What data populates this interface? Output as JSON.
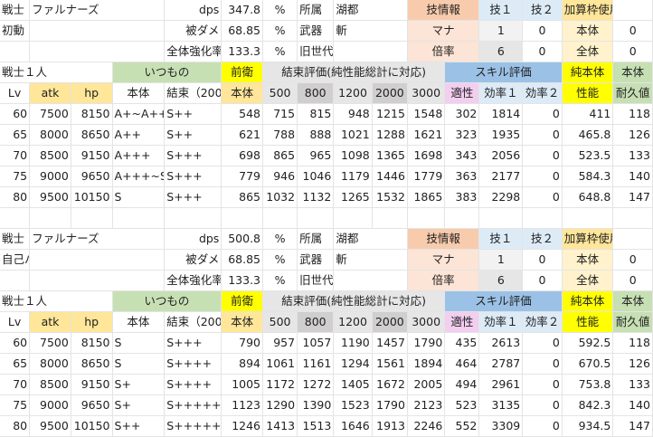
{
  "sheet": {
    "blocks": [
      {
        "info_rows": [
          [
            "戦士",
            "ファルナーズ",
            "",
            "dps",
            "347.8",
            "%",
            "所属",
            "湖都",
            "",
            "技情報",
            "技１",
            "技２",
            "加算枠使用率",
            ""
          ],
          [
            "初動",
            "",
            "",
            "被ダメ",
            "68.85",
            "%",
            "武器",
            "斬",
            "",
            "マナ",
            "1",
            "0",
            "本体",
            "0"
          ],
          [
            "",
            "",
            "",
            "全体強化率",
            "133.3",
            "%",
            "旧世代",
            "",
            "",
            "倍率",
            "6",
            "0",
            "全体",
            "0"
          ]
        ],
        "header_row": [
          "戦士１人",
          "",
          "",
          "いつもの",
          "",
          "前衛",
          "結束評価(純性能総計に対応)",
          "",
          "",
          "",
          "",
          "スキル評価",
          "",
          "",
          "純本体",
          "本体"
        ],
        "col_row": [
          "Lv",
          "atk",
          "hp",
          "本体",
          "結束（2000)",
          "本体",
          "500",
          "800",
          "1200",
          "2000",
          "3000",
          "適性",
          "効率１",
          "効率２",
          "性能",
          "耐久値"
        ],
        "data_rows": [
          [
            "60",
            "7500",
            "8150",
            "A+~A++",
            "S++",
            "548",
            "715",
            "815",
            "948",
            "1215",
            "1548",
            "302",
            "1814",
            "0",
            "411",
            "118"
          ],
          [
            "65",
            "8000",
            "8650",
            "A++",
            "S++",
            "621",
            "788",
            "888",
            "1021",
            "1288",
            "1621",
            "323",
            "1935",
            "0",
            "465.8",
            "126"
          ],
          [
            "70",
            "8500",
            "9150",
            "A+++",
            "S+++",
            "698",
            "865",
            "965",
            "1098",
            "1365",
            "1698",
            "343",
            "2056",
            "0",
            "523.5",
            "133"
          ],
          [
            "75",
            "9000",
            "9650",
            "A+++~S",
            "S+++",
            "779",
            "946",
            "1046",
            "1179",
            "1446",
            "1779",
            "363",
            "2177",
            "0",
            "584.3",
            "140"
          ],
          [
            "80",
            "9500",
            "10150",
            "S",
            "S+++",
            "865",
            "1032",
            "1132",
            "1265",
            "1532",
            "1865",
            "383",
            "2298",
            "0",
            "648.8",
            "147"
          ]
        ]
      },
      {
        "info_rows": [
          [
            "戦士",
            "ファルナーズ",
            "",
            "dps",
            "500.8",
            "%",
            "所属",
            "湖都",
            "",
            "技情報",
            "技１",
            "技２",
            "加算枠使用率",
            ""
          ],
          [
            "自己バフ全開",
            "",
            "",
            "被ダメ",
            "68.85",
            "%",
            "武器",
            "斬",
            "",
            "マナ",
            "1",
            "0",
            "本体",
            "0"
          ],
          [
            "",
            "",
            "",
            "全体強化率",
            "133.3",
            "%",
            "旧世代",
            "",
            "",
            "倍率",
            "6",
            "0",
            "全体",
            "0"
          ]
        ],
        "header_row": [
          "戦士１人",
          "",
          "",
          "いつもの",
          "",
          "前衛",
          "結束評価(純性能総計に対応)",
          "",
          "",
          "",
          "",
          "スキル評価",
          "",
          "",
          "純本体",
          "本体"
        ],
        "col_row": [
          "Lv",
          "atk",
          "hp",
          "本体",
          "結束（2000)",
          "本体",
          "500",
          "800",
          "1200",
          "2000",
          "3000",
          "適性",
          "効率１",
          "効率２",
          "性能",
          "耐久値"
        ],
        "data_rows": [
          [
            "60",
            "7500",
            "8150",
            "S",
            "S+++",
            "790",
            "957",
            "1057",
            "1190",
            "1457",
            "1790",
            "435",
            "2613",
            "0",
            "592.5",
            "118"
          ],
          [
            "65",
            "8000",
            "8650",
            "S",
            "S++++",
            "894",
            "1061",
            "1161",
            "1294",
            "1561",
            "1894",
            "464",
            "2787",
            "0",
            "670.5",
            "126"
          ],
          [
            "70",
            "8500",
            "9150",
            "S+",
            "S++++",
            "1005",
            "1172",
            "1272",
            "1405",
            "1672",
            "2005",
            "494",
            "2961",
            "0",
            "753.8",
            "133"
          ],
          [
            "75",
            "9000",
            "9650",
            "S+",
            "S+++++",
            "1123",
            "1290",
            "1390",
            "1523",
            "1790",
            "2123",
            "523",
            "3135",
            "0",
            "842.3",
            "140"
          ],
          [
            "80",
            "9500",
            "10150",
            "S++",
            "S+++++",
            "1246",
            "1413",
            "1513",
            "1646",
            "1913",
            "2246",
            "552",
            "3309",
            "0",
            "934.5",
            "147"
          ]
        ]
      }
    ]
  }
}
